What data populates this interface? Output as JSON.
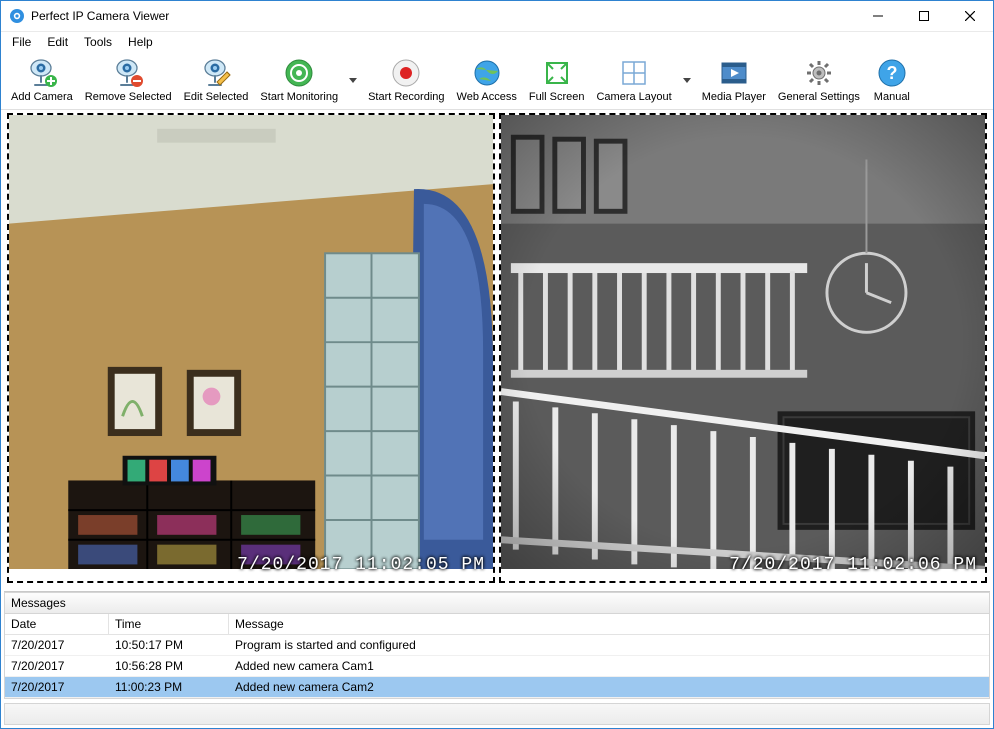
{
  "window": {
    "title": "Perfect IP Camera Viewer"
  },
  "menu": {
    "file": "File",
    "edit": "Edit",
    "tools": "Tools",
    "help": "Help"
  },
  "toolbar": {
    "add": "Add Camera",
    "remove": "Remove Selected",
    "editSel": "Edit Selected",
    "startMon": "Start Monitoring",
    "startRec": "Start Recording",
    "web": "Web Access",
    "full": "Full Screen",
    "layout": "Camera Layout",
    "media": "Media Player",
    "settings": "General Settings",
    "manual": "Manual"
  },
  "cams": {
    "cam1": {
      "timestamp": "7/20/2017  11:02:05  PM"
    },
    "cam2": {
      "timestamp": "7/20/2017  11:02:06  PM"
    }
  },
  "messages": {
    "title": "Messages",
    "columns": {
      "date": "Date",
      "time": "Time",
      "msg": "Message"
    },
    "rows": [
      {
        "date": "7/20/2017",
        "time": "10:50:17 PM",
        "msg": "Program is started and configured"
      },
      {
        "date": "7/20/2017",
        "time": "10:56:28 PM",
        "msg": "Added new camera Cam1"
      },
      {
        "date": "7/20/2017",
        "time": "11:00:23 PM",
        "msg": "Added new camera Cam2"
      }
    ],
    "selectedIndex": 2
  }
}
